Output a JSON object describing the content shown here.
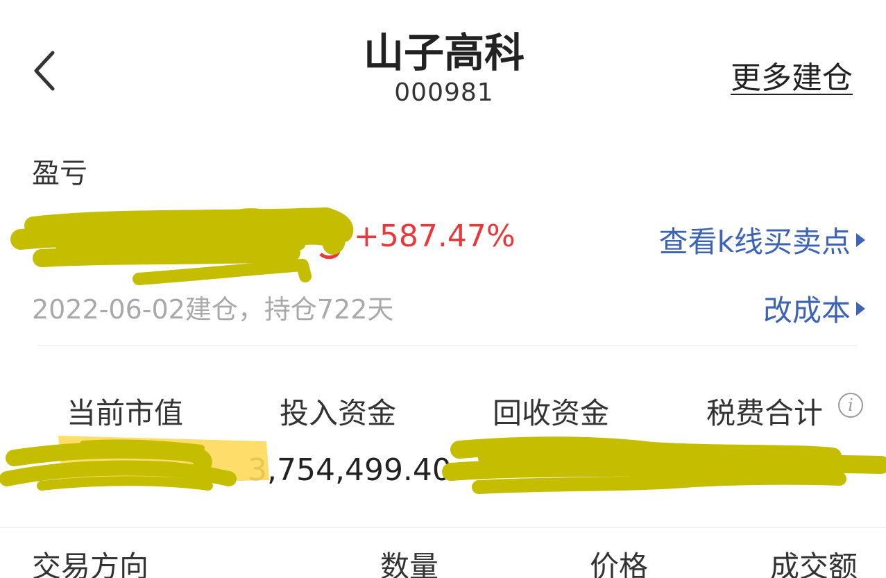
{
  "header": {
    "back_icon": "chevron-left-icon",
    "title": "山子高科",
    "code": "000981",
    "more_label": "更多建仓"
  },
  "profit": {
    "label": "盈亏",
    "percent": "+587.47%",
    "kline_link": "查看k线买卖点",
    "built_info": "2022-06-02建仓，持仓722天",
    "cost_link": "改成本"
  },
  "stats": {
    "labels": [
      "当前市值",
      "投入资金",
      "回收资金",
      "税费合计"
    ],
    "invested_value": "3,754,499.40",
    "info_icon": "info-icon"
  },
  "table": {
    "headers": [
      "交易方向",
      "数量",
      "价格",
      "成交额"
    ]
  },
  "colors": {
    "positive": "#e8383b",
    "link": "#3d63b7",
    "redaction": "#c5be00",
    "redaction_light": "#ffd95a"
  }
}
